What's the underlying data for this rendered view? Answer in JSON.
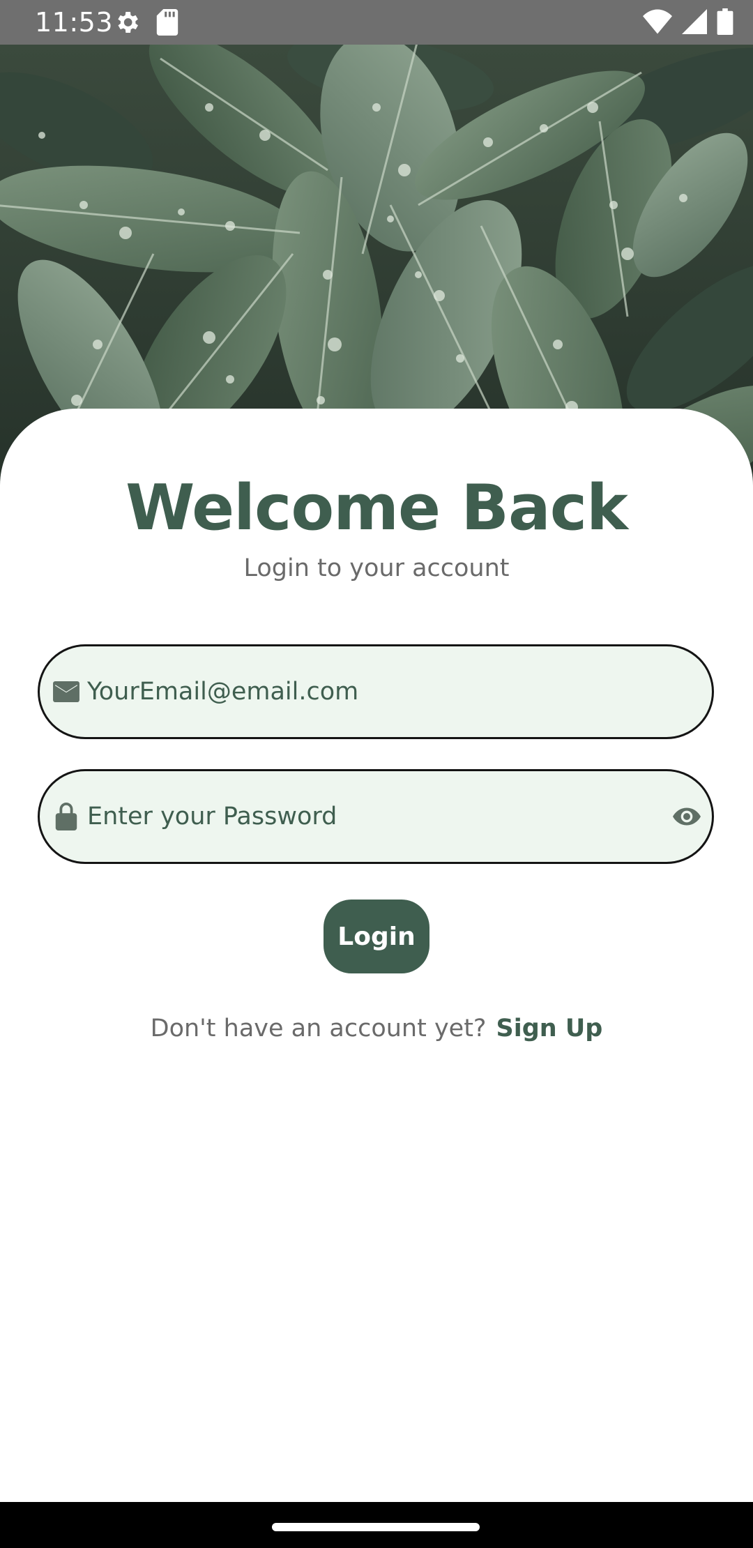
{
  "status_bar": {
    "time": "11:53",
    "icons": [
      "settings-gear-icon",
      "sd-card-icon",
      "wifi-icon",
      "cell-signal-icon",
      "battery-icon"
    ]
  },
  "hero": {
    "image": "rainy-green-leaves-photo"
  },
  "login": {
    "title": "Welcome Back",
    "subtitle": "Login to your account",
    "email": {
      "placeholder": "YourEmail@email.com",
      "value": "",
      "icon": "mail-icon"
    },
    "password": {
      "placeholder": "Enter your Password",
      "value": "",
      "icon": "lock-icon",
      "toggle_icon": "eye-icon"
    },
    "button_label": "Login",
    "signup_prompt": "Don't have an account yet?",
    "signup_link": "Sign Up"
  },
  "colors": {
    "primary": "#3f5e4f",
    "field_fill": "#eef6ef",
    "field_border": "#141414",
    "muted_text": "#6a6a6a",
    "status_bar": "#6f6f6f",
    "nav_bar": "#000000"
  }
}
